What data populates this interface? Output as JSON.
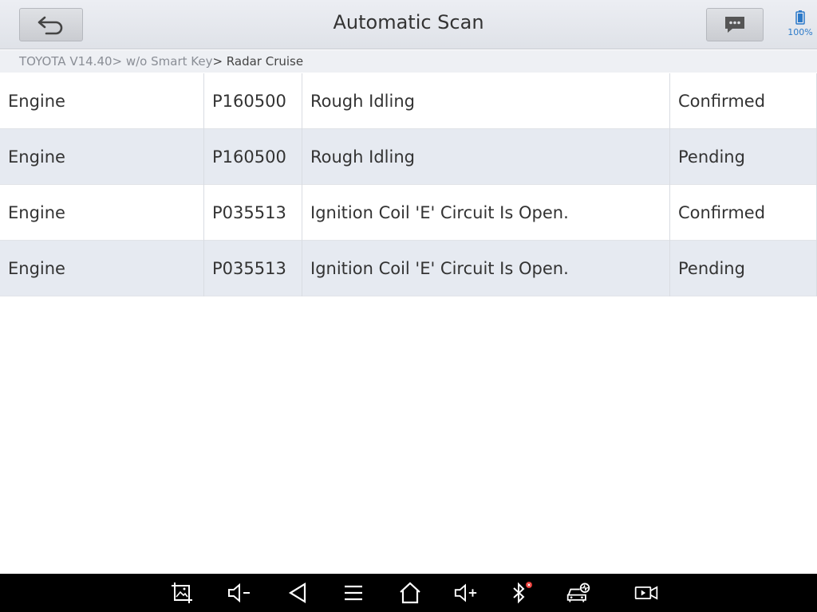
{
  "header": {
    "title": "Automatic Scan",
    "back_icon": "back-arrow-icon",
    "message_icon": "chat-bubble-icon",
    "battery": {
      "icon": "battery-icon",
      "label": "100%",
      "level_percent": 100,
      "color": "#2b79c9"
    }
  },
  "breadcrumb": {
    "path": "TOYOTA V14.40> w/o Smart Key",
    "current": "> Radar Cruise"
  },
  "dtc_table": {
    "rows": [
      {
        "system": "Engine",
        "code": "P160500",
        "description": "Rough Idling",
        "status": "Confirmed"
      },
      {
        "system": "Engine",
        "code": "P160500",
        "description": "Rough Idling",
        "status": "Pending"
      },
      {
        "system": "Engine",
        "code": "P035513",
        "description": "Ignition Coil 'E' Circuit Is Open.",
        "status": "Confirmed"
      },
      {
        "system": "Engine",
        "code": "P035513",
        "description": "Ignition Coil 'E' Circuit Is Open.",
        "status": "Pending"
      }
    ]
  },
  "navbar": {
    "icons": [
      "screenshot-icon",
      "volume-down-icon",
      "back-triangle-icon",
      "menu-icon",
      "home-icon",
      "volume-up-icon",
      "bluetooth-icon",
      "car-diagnostic-icon",
      "screen-record-icon"
    ],
    "bluetooth_badge_color": "#e53935"
  }
}
